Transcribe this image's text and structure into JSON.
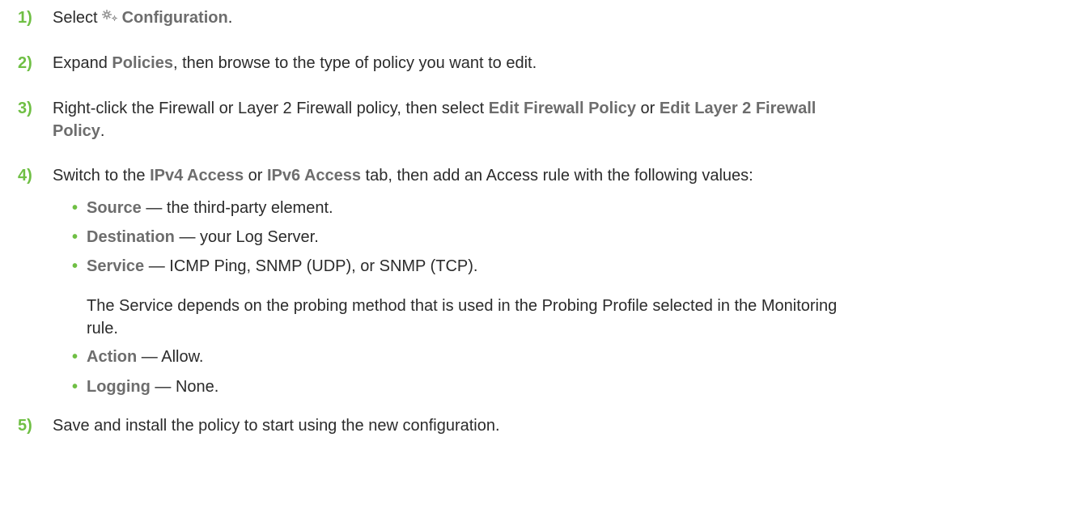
{
  "steps": [
    {
      "number": "1)",
      "parts": {
        "a": "Select",
        "ui1": "Configuration",
        "end": "."
      }
    },
    {
      "number": "2)",
      "parts": {
        "a": "Expand ",
        "ui1": "Policies",
        "b": ", then browse to the type of policy you want to edit."
      }
    },
    {
      "number": "3)",
      "parts": {
        "a": "Right-click the Firewall or Layer 2 Firewall policy, then select ",
        "ui1": "Edit Firewall Policy",
        "b": " or ",
        "ui2": "Edit Layer 2 Firewall",
        "ui3": "Policy",
        "end": "."
      }
    },
    {
      "number": "4)",
      "parts": {
        "a": "Switch to the ",
        "ui1": "IPv4 Access",
        "b": " or ",
        "ui2": "IPv6 Access",
        "c": " tab, then add an Access rule with the following values:"
      },
      "bullets": [
        {
          "bullet": "•",
          "label": "Source",
          "text": " — the third-party element."
        },
        {
          "bullet": "•",
          "label": "Destination",
          "text": " — your Log Server."
        },
        {
          "bullet": "•",
          "label": "Service",
          "text": " — ICMP Ping, SNMP (UDP), or SNMP (TCP)."
        },
        {
          "bullet": "•",
          "label": "Action",
          "text": " — Allow."
        },
        {
          "bullet": "•",
          "label": "Logging",
          "text": " — None."
        }
      ],
      "note_line1": "The Service depends on the probing method that is used in the Probing Profile selected in the Monitoring",
      "note_line2": "rule."
    },
    {
      "number": "5)",
      "parts": {
        "a": "Save and install the policy to start using the new configuration."
      }
    }
  ],
  "icons": {
    "configuration": "gear-icon"
  },
  "colors": {
    "step_number": "#6fbf44",
    "ui_term": "#6d6d6d",
    "body_text": "#2b2b2b"
  }
}
